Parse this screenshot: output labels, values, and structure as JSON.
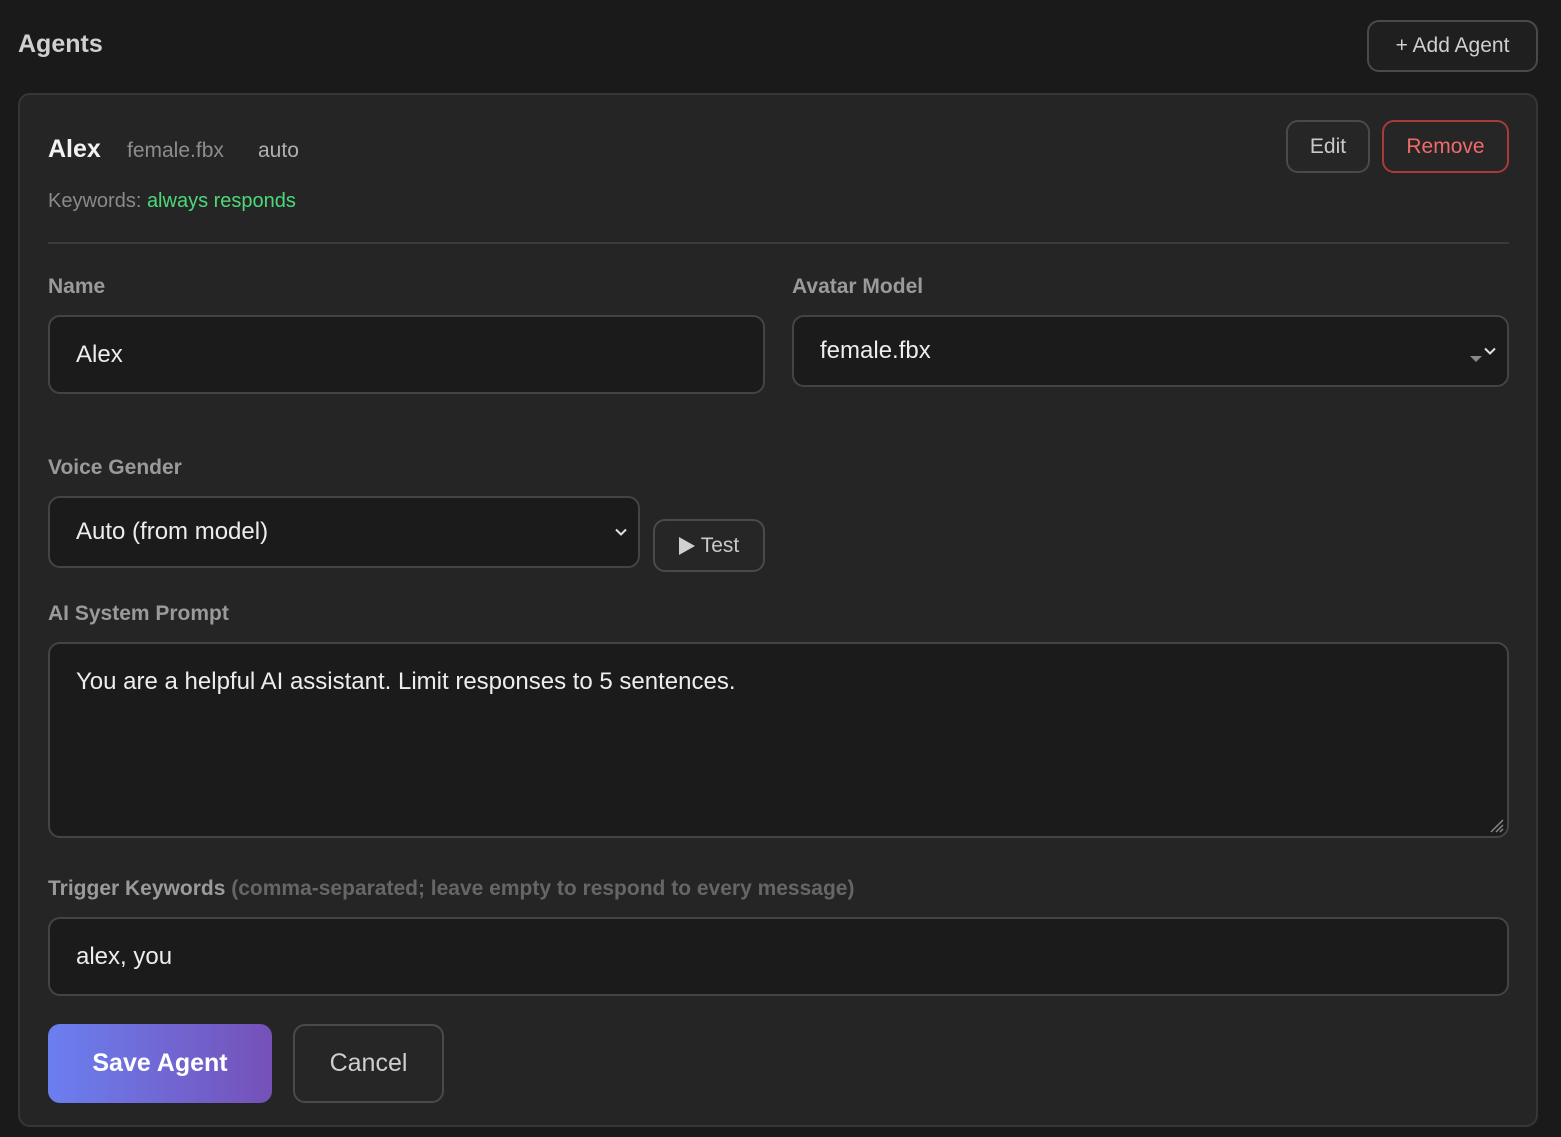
{
  "header": {
    "title": "Agents",
    "add_button_label": "+ Add Agent"
  },
  "agent": {
    "name": "Alex",
    "model": "female.fbx",
    "gender": "auto",
    "keywords_label": "Keywords:",
    "keywords_value": "always responds",
    "edit_label": "Edit",
    "remove_label": "Remove"
  },
  "form": {
    "name_label": "Name",
    "name_value": "Alex",
    "avatar_label": "Avatar Model",
    "avatar_value": "female.fbx",
    "voice_label": "Voice Gender",
    "voice_value": "Auto (from model)",
    "test_label": "Test",
    "prompt_label": "AI System Prompt",
    "prompt_value": "You are a helpful AI assistant. Limit responses to 5 sentences.",
    "keywords_label": "Trigger Keywords",
    "keywords_hint": "(comma-separated; leave empty to respond to every message)",
    "keywords_value": "alex, you",
    "save_label": "Save Agent",
    "cancel_label": "Cancel"
  },
  "colors": {
    "background": "#1a1a1a",
    "card": "#252525",
    "accent_green": "#4cd97a",
    "danger": "#f06a6a",
    "gradient_start": "#6b7ff0",
    "gradient_end": "#7551b8"
  },
  "icons": {
    "add": "plus-icon",
    "select": "chevron-down-icon",
    "test": "play-icon",
    "resize": "resize-handle-icon"
  }
}
